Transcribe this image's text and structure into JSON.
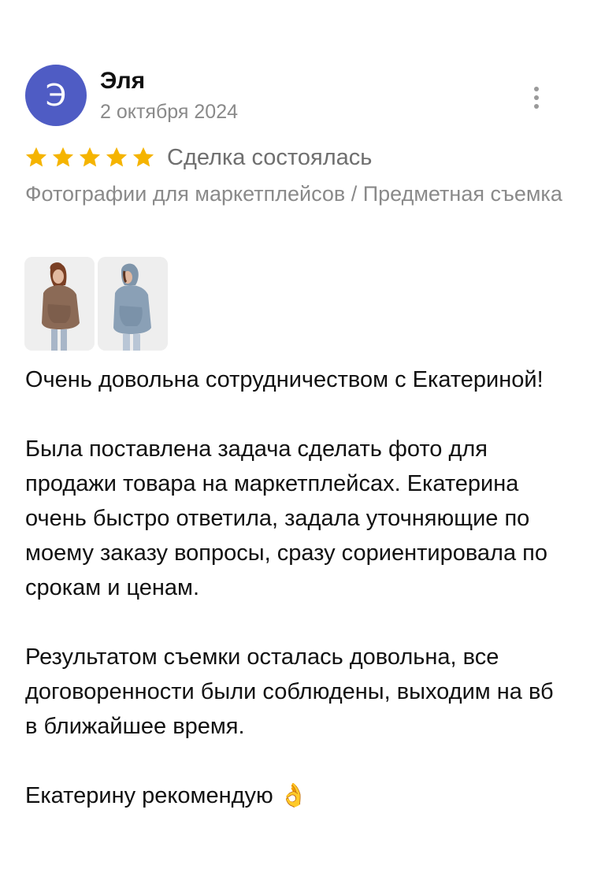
{
  "author": {
    "initial": "Э",
    "name": "Эля",
    "avatar_color": "#4f5cc4"
  },
  "date": "2 октября 2024",
  "menu_icon": "more-vertical-icon",
  "rating": {
    "stars": 5,
    "max": 5,
    "star_color": "#f5b400",
    "status": "Сделка состоялась"
  },
  "category": "Фотографии для маркетплейсов / Предметная съемка",
  "photos": [
    {
      "subject": "woman in brown hoodie"
    },
    {
      "subject": "woman in blue hoodie"
    }
  ],
  "text": "Очень довольна сотрудничеством с Екатериной!\n\nБыла поставлена задача сделать фото для продажи товара на маркетплейсах. Екатерина очень быстро ответила, задала уточняющие по моему заказу вопросы, сразу сориентировала по срокам и ценам.\n\nРезультатом съемки осталась довольна, все договоренности были соблюдены, выходим на вб в ближайшее время.\n\nЕкатерину рекомендую 👌"
}
